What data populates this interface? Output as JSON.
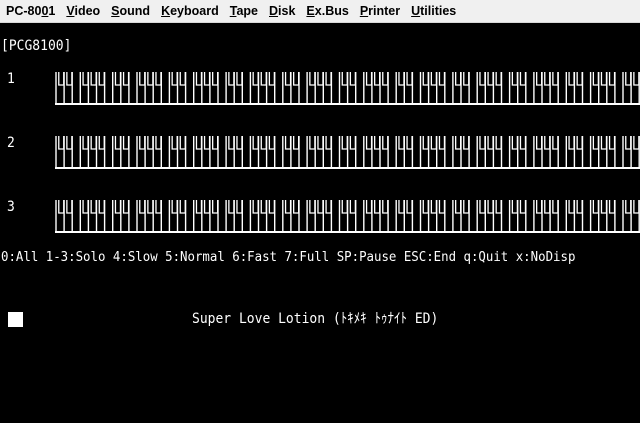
{
  "menu": {
    "items": [
      {
        "label": "PC-8001",
        "hotkey_index": 5
      },
      {
        "label": "Video",
        "hotkey_index": 0
      },
      {
        "label": "Sound",
        "hotkey_index": 0
      },
      {
        "label": "Keyboard",
        "hotkey_index": 0
      },
      {
        "label": "Tape",
        "hotkey_index": 0
      },
      {
        "label": "Disk",
        "hotkey_index": 0
      },
      {
        "label": "Ex.Bus",
        "hotkey_index": 0
      },
      {
        "label": "Printer",
        "hotkey_index": 0
      },
      {
        "label": "Utilities",
        "hotkey_index": 0
      }
    ]
  },
  "screen": {
    "header": "[PCG8100]",
    "channels": [
      {
        "label": "1"
      },
      {
        "label": "2"
      },
      {
        "label": "3"
      }
    ],
    "help": "0:All 1-3:Solo 4:Slow 5:Normal 6:Fast 7:Full SP:Pause ESC:End q:Quit x:NoDisp",
    "song_title": "Super Love Lotion (ﾄｷﾒｷ ﾄｩﾅｲﾄ ED)"
  },
  "colors": {
    "screen_bg": "#000000",
    "screen_fg": "#ffffff",
    "menubar_bg": "#f0f0f0"
  }
}
